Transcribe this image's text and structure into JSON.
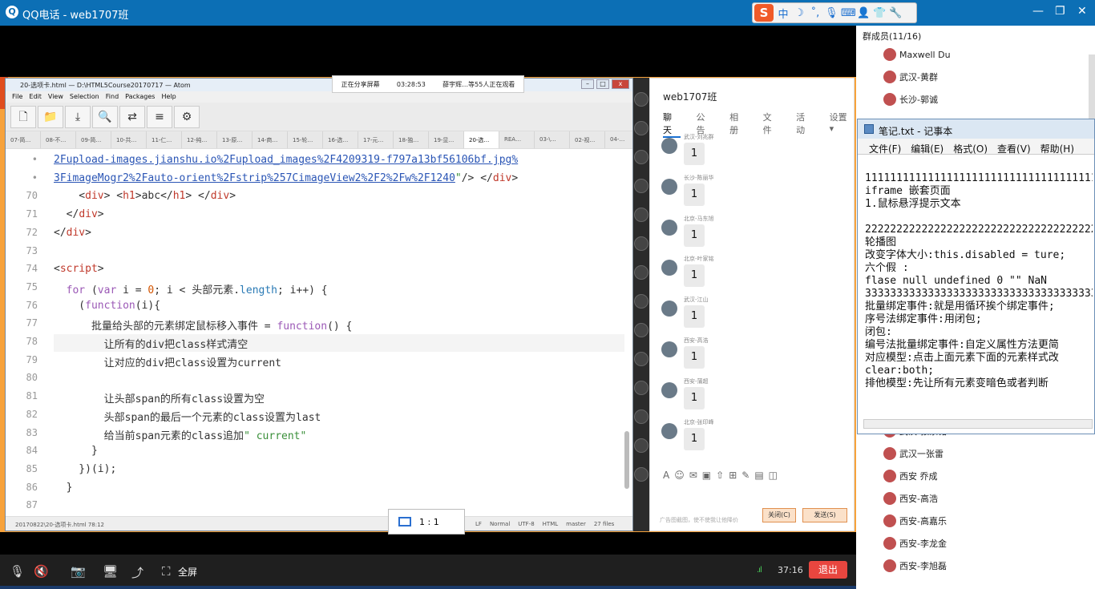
{
  "qq": {
    "title": "QQ电话 - web1707班",
    "logo": "qq-phone-icon"
  },
  "ime": {
    "s": "S",
    "items": [
      "中",
      "☽",
      "˚,",
      "🎙",
      "⌨",
      "👤",
      "👕",
      "🔧"
    ]
  },
  "share_bar": {
    "left": "正在分享屏幕",
    "time": "03:28:53",
    "right": "薛宇辉…等55人正在观看"
  },
  "atom": {
    "title": "20-选项卡.html — D:\\HTML5Course20170717 — Atom",
    "menu": [
      "File",
      "Edit",
      "View",
      "Selection",
      "Find",
      "Packages",
      "Help"
    ],
    "tools": [
      "new-file-icon",
      "folder-icon",
      "download-icon",
      "search-icon",
      "shuffle-icon",
      "list-icon",
      "gear-icon"
    ],
    "tools_glyphs": [
      "🗋",
      "📁",
      "⤓",
      "🔍",
      "⇄",
      "≡",
      "⚙"
    ],
    "tabs": [
      "07-简…",
      "08-不…",
      "09-简…",
      "10-共…",
      "11-仁…",
      "12-纯…",
      "13-原…",
      "14-商…",
      "15-轮…",
      "16-选…",
      "17-元…",
      "18-独…",
      "19-显…",
      "20-选…",
      "REA…",
      "03-\\…",
      "02-视…",
      "04-…"
    ],
    "active_tab": 13,
    "status_left": "20170822\\20-选项卡.html   78:12",
    "status_right": [
      "LF",
      "Normal",
      "UTF-8",
      "HTML",
      "master",
      "27 files"
    ],
    "zoom": "1 : 1"
  },
  "code_lines": [
    {
      "n": "•",
      "html": "<span class=\"url\">2Fupload-images.jianshu.io%2Fupload_images%2F4209319-f797a13bf56106bf.jpg%</span>"
    },
    {
      "n": "•",
      "html": "<span class=\"url\">3FimageMogr2%2Fauto-orient%2Fstrip%257CimageView2%2F2%2Fw%2F1240</span><span class=\"str\">\"</span>/&gt; &lt;/<span class=\"tag\">div</span>&gt;"
    },
    {
      "n": "70",
      "html": "    &lt;<span class=\"tag\">div</span>&gt; &lt;<span class=\"tag\">h1</span>&gt;abc&lt;/<span class=\"tag\">h1</span>&gt; &lt;/<span class=\"tag\">div</span>&gt;"
    },
    {
      "n": "71",
      "html": "  &lt;/<span class=\"tag\">div</span>&gt;"
    },
    {
      "n": "72",
      "html": "&lt;/<span class=\"tag\">div</span>&gt;"
    },
    {
      "n": "73",
      "html": ""
    },
    {
      "n": "74",
      "html": "&lt;<span class=\"tag\">script</span>&gt;"
    },
    {
      "n": "75",
      "html": "  <span class=\"kw\">for</span> (<span class=\"kw\">var</span> i = <span class=\"num\">0</span>; i &lt; 头部元素.<span class=\"fn\">length</span>; i++) {"
    },
    {
      "n": "76",
      "html": "    (<span class=\"kw\">function</span>(i){"
    },
    {
      "n": "77",
      "html": "      批量给头部的元素绑定鼠标移入事件 = <span class=\"kw\">function</span>() {"
    },
    {
      "n": "78",
      "html": "        让所有的div把class样式清空"
    },
    {
      "n": "79",
      "html": "        让对应的div把class设置为current"
    },
    {
      "n": "80",
      "html": ""
    },
    {
      "n": "81",
      "html": "        让头部span的所有class设置为空"
    },
    {
      "n": "82",
      "html": "        头部span的最后一个元素的class设置为last"
    },
    {
      "n": "83",
      "html": "        给当前span元素的class追加<span class=\"str\">\" current\"</span>"
    },
    {
      "n": "84",
      "html": "      }"
    },
    {
      "n": "85",
      "html": "    })(i);"
    },
    {
      "n": "86",
      "html": "  }"
    },
    {
      "n": "87",
      "html": ""
    }
  ],
  "group": {
    "name": "web1707班",
    "tabs": [
      "聊天",
      "公告",
      "相册",
      "文件",
      "活动",
      "设置 ▾"
    ],
    "messages": [
      {
        "name": "武汉-刘兆群",
        "text": "1"
      },
      {
        "name": "长沙-陈丽华",
        "text": "1"
      },
      {
        "name": "北京-马东旭",
        "text": "1"
      },
      {
        "name": "北京-叶家铭",
        "text": "1"
      },
      {
        "name": "武汉-江山",
        "text": "1"
      },
      {
        "name": "西安-高浩",
        "text": "1"
      },
      {
        "name": "西安-蒲超",
        "text": "1"
      },
      {
        "name": "北京-张印峰",
        "text": "1"
      }
    ],
    "compose_icons": [
      "A",
      "☺",
      "✉",
      "▣",
      "⇧",
      "⊞",
      "✎",
      "▤",
      "◫"
    ],
    "hint": "广告图截图，使不使我让他降价",
    "close_btn": "关闭(C)",
    "send_btn": "发送(S)"
  },
  "members": {
    "header": "群成员(11/16)",
    "list": [
      "Maxwell Du",
      "武汉-黄群",
      "长沙-郭诚",
      "武汉-张家铭",
      "武汉一张雷",
      "西安 乔成",
      "西安-高浩",
      "西安-高嘉乐",
      "西安-李龙金",
      "西安-李旭磊"
    ]
  },
  "notepad": {
    "title": "笔记.txt - 记事本",
    "menu": [
      "文件(F)",
      "编辑(E)",
      "格式(O)",
      "查看(V)",
      "帮助(H)"
    ],
    "text": "11111111111111111111111111111111111111\niframe 嵌套页面\n1.鼠标悬浮提示文本\n\n22222222222222222222222222222222222222\n轮播图\n改变字体大小:this.disabled = ture;\n六个假 :\nflase null undefined 0 \"\" NaN\n33333333333333333333333333333333333333\n批量绑定事件:就是用循环挨个绑定事件;\n序号法绑定事件:用闭包;\n闭包:\n编号法批量绑定事件:自定义属性方法更简\n对应模型:点击上面元素下面的元素样式改\nclear:both;\n排他模型:先让所有元素变暗色或者判断"
  },
  "control": {
    "full_label": "全屏",
    "time": "37:16",
    "exit_label": "退出"
  }
}
